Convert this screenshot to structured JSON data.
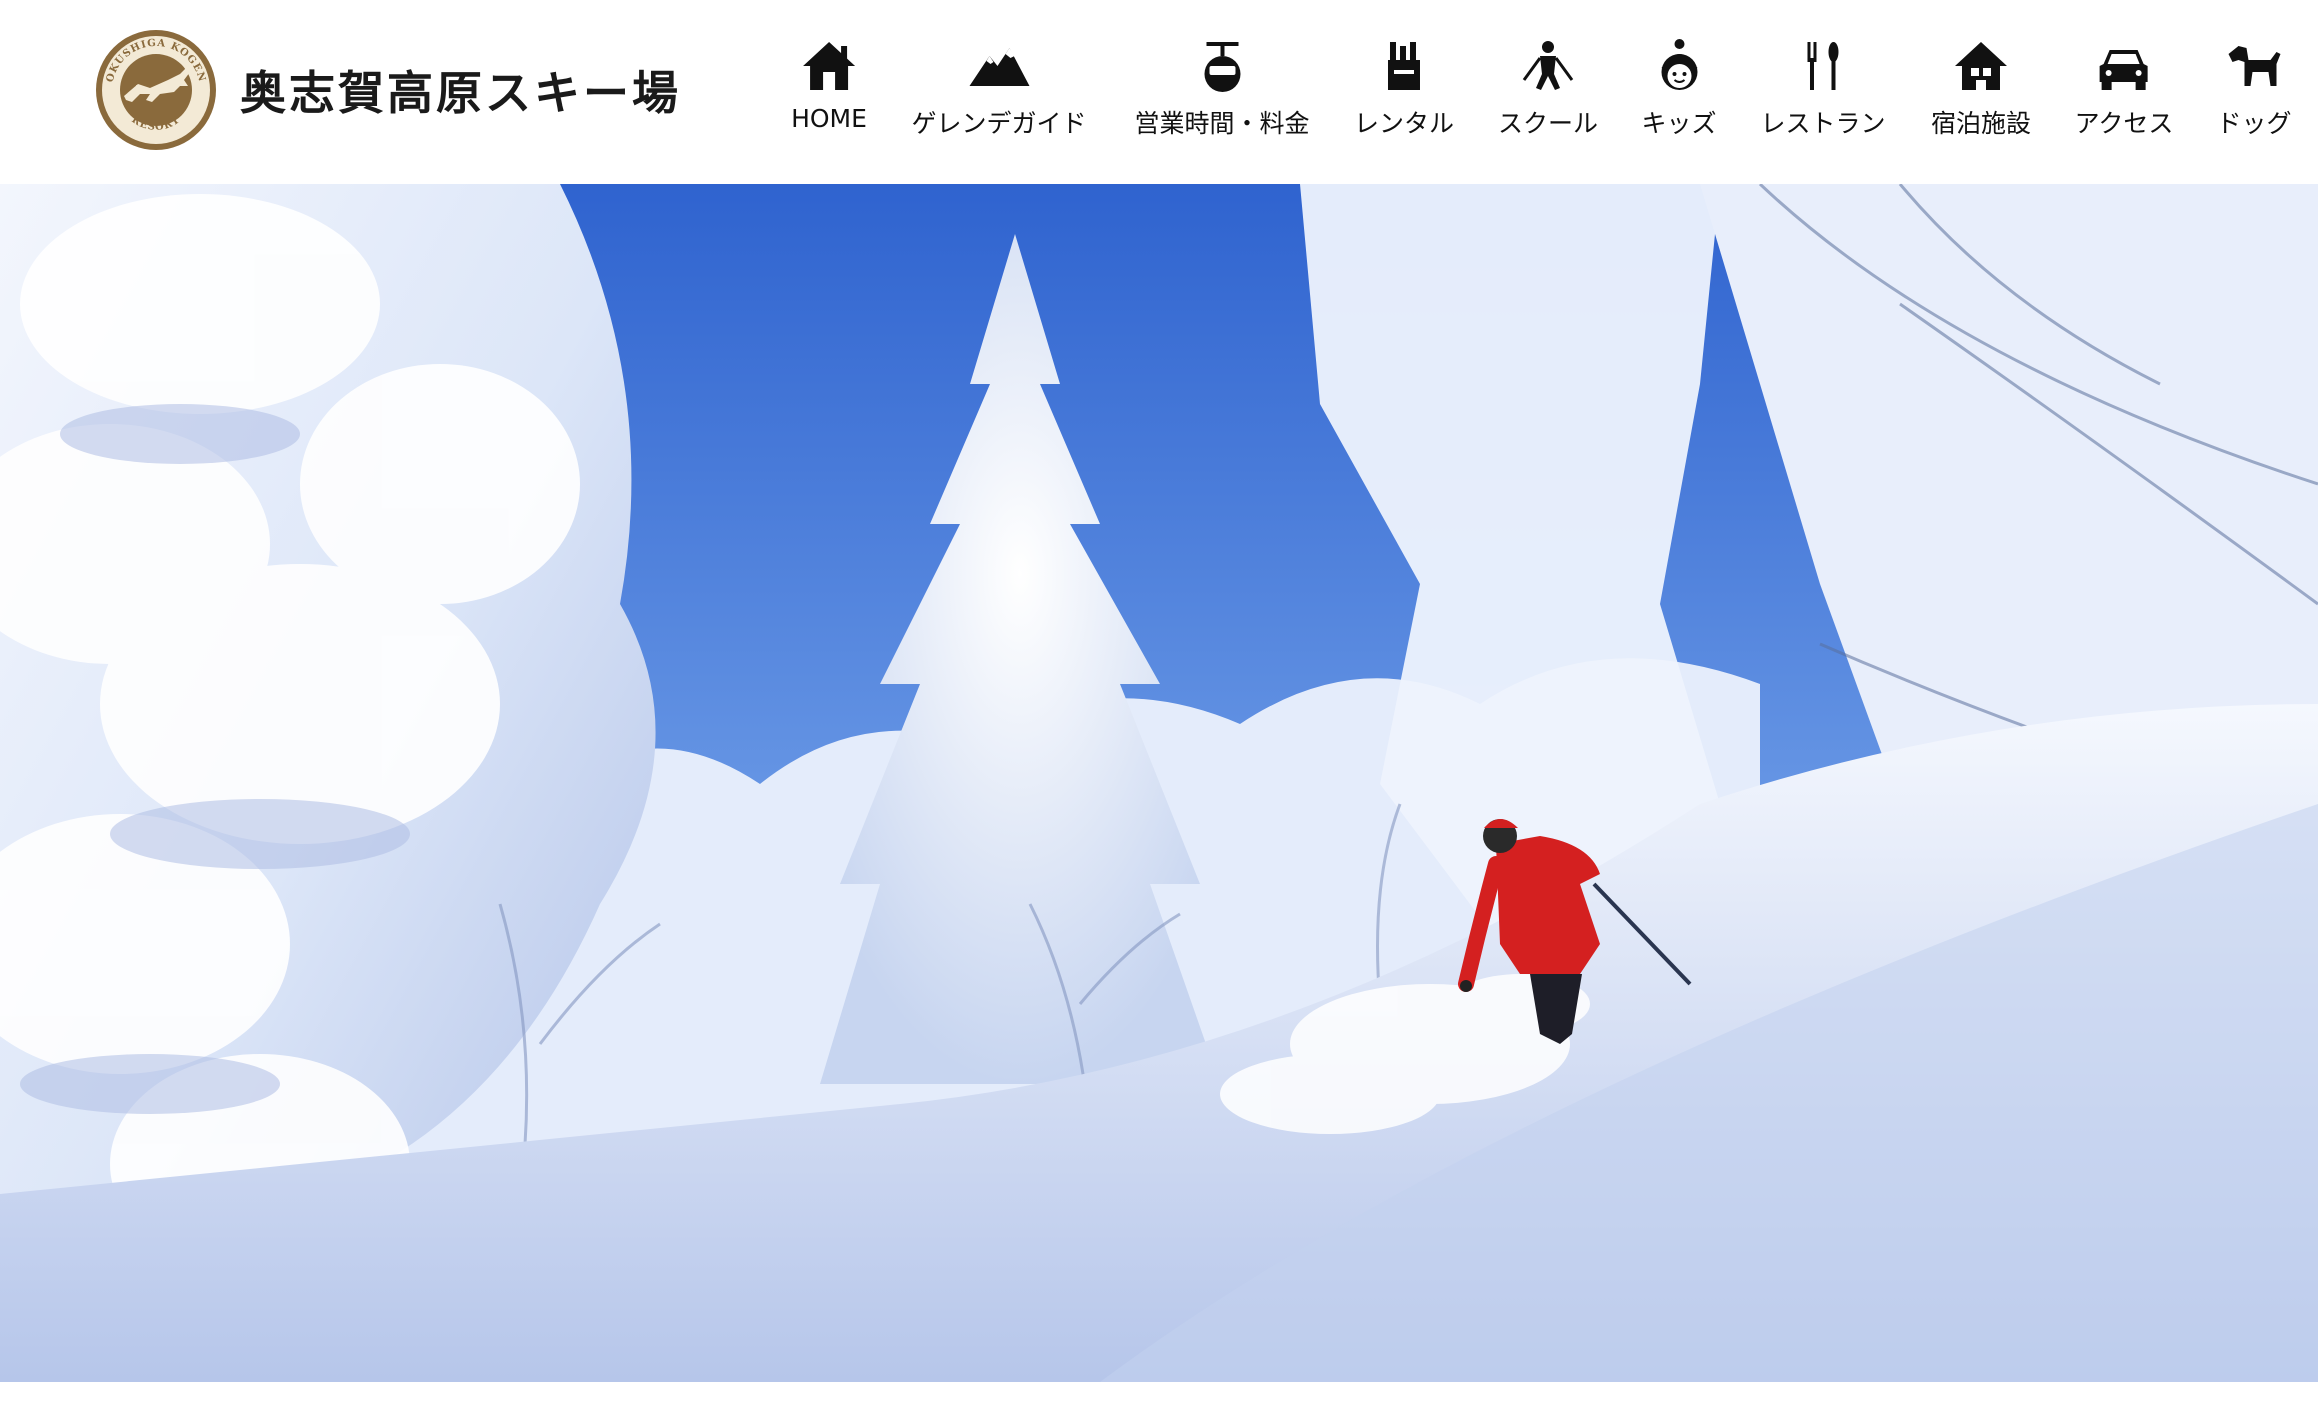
{
  "site": {
    "logo_ring_text": "OKUSHIGA KOGEN",
    "logo_bottom_text": "RESORT",
    "name": "奥志賀高原スキー場"
  },
  "nav": {
    "items": [
      {
        "label": "HOME",
        "icon": "house-icon"
      },
      {
        "label": "ゲレンデガイド",
        "icon": "mountain-icon"
      },
      {
        "label": "営業時間・料金",
        "icon": "gondola-icon"
      },
      {
        "label": "レンタル",
        "icon": "rental-icon"
      },
      {
        "label": "スクール",
        "icon": "skier-icon"
      },
      {
        "label": "キッズ",
        "icon": "kid-icon"
      },
      {
        "label": "レストラン",
        "icon": "cutlery-icon"
      },
      {
        "label": "宿泊施設",
        "icon": "lodge-icon"
      },
      {
        "label": "アクセス",
        "icon": "car-icon"
      },
      {
        "label": "ドッグ",
        "icon": "dog-icon"
      }
    ]
  },
  "colors": {
    "logo_brown": "#8a6a3c",
    "logo_cream": "#f3ead6",
    "sky": "#3f78dc",
    "skier_red": "#d42020"
  }
}
